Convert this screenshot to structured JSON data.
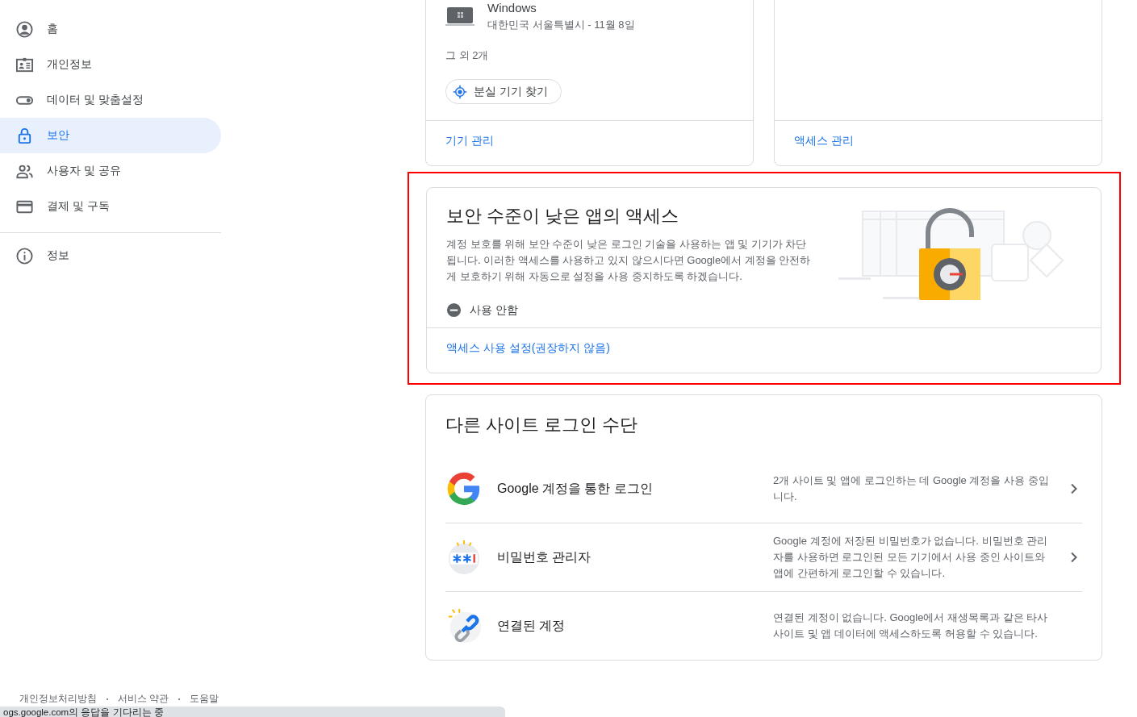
{
  "sidebar": {
    "items": [
      {
        "label": "홈",
        "selected": false
      },
      {
        "label": "개인정보",
        "selected": false
      },
      {
        "label": "데이터 및 맞춤설정",
        "selected": false
      },
      {
        "label": "보안",
        "selected": true
      },
      {
        "label": "사용자 및 공유",
        "selected": false
      },
      {
        "label": "결제 및 구독",
        "selected": false
      }
    ],
    "footer_items": [
      {
        "label": "정보",
        "selected": false
      }
    ]
  },
  "devices_card": {
    "device_name": "Windows",
    "device_detail": "대한민국 서울특별시 - 11월 8일",
    "more": "그 외 2개",
    "find_button": "분실 기기 찾기",
    "link": "기기 관리"
  },
  "access_card": {
    "link": "액세스 관리"
  },
  "less_secure_card": {
    "highlighted": true,
    "title": "보안 수준이 낮은 앱의 액세스",
    "description": "계정 보호를 위해 보안 수준이 낮은 로그인 기술을 사용하는 앱 및 기기가 차단됩니다. 이러한 액세스를 사용하고 있지 않으시다면 Google에서 계정을 안전하게 보호하기 위해 자동으로 설정을 사용 중지하도록 하겠습니다.",
    "status": "사용 안함",
    "status_on": false,
    "link": "액세스 사용 설정(권장하지 않음)"
  },
  "other_signin_card": {
    "title": "다른 사이트 로그인 수단",
    "rows": [
      {
        "kind": "google",
        "label": "Google 계정을 통한 로그인",
        "description": "2개 사이트 및 앱에 로그인하는 데 Google 계정을 사용 중입니다.",
        "chevron": true
      },
      {
        "kind": "password",
        "label": "비밀번호 관리자",
        "description": "Google 계정에 저장된 비밀번호가 없습니다. 비밀번호 관리자를 사용하면 로그인된 모든 기기에서 사용 중인 사이트와 앱에 간편하게 로그인할 수 있습니다.",
        "chevron": true
      },
      {
        "kind": "link",
        "label": "연결된 계정",
        "description": "연결된 계정이 없습니다. Google에서 재생목록과 같은 타사 사이트 및 앱 데이터에 액세스하도록 허용할 수 있습니다.",
        "chevron": false
      }
    ]
  },
  "footer_links": [
    "개인정보처리방침",
    "서비스 약관",
    "도움말"
  ],
  "status_bar": {
    "text": "ogs.google.com의 응답을 기다리는 중"
  }
}
